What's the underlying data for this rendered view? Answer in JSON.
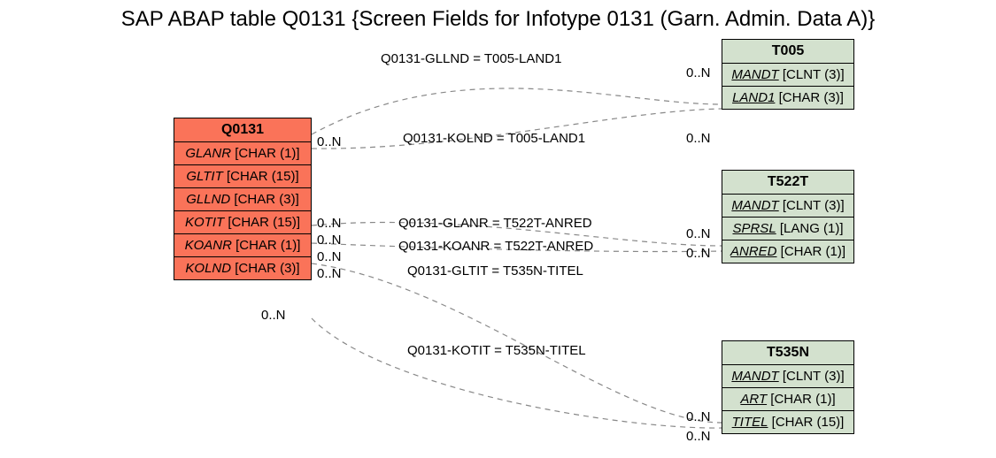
{
  "title": "SAP ABAP table Q0131 {Screen Fields for Infotype 0131 (Garn. Admin. Data A)}",
  "entities": {
    "q0131": {
      "name": "Q0131",
      "fields": [
        {
          "name": "GLANR",
          "type": "[CHAR (1)]",
          "ul": false
        },
        {
          "name": "GLTIT",
          "type": "[CHAR (15)]",
          "ul": false
        },
        {
          "name": "GLLND",
          "type": "[CHAR (3)]",
          "ul": false
        },
        {
          "name": "KOTIT",
          "type": "[CHAR (15)]",
          "ul": false
        },
        {
          "name": "KOANR",
          "type": "[CHAR (1)]",
          "ul": false
        },
        {
          "name": "KOLND",
          "type": "[CHAR (3)]",
          "ul": false
        }
      ]
    },
    "t005": {
      "name": "T005",
      "fields": [
        {
          "name": "MANDT",
          "type": "[CLNT (3)]",
          "ul": true
        },
        {
          "name": "LAND1",
          "type": "[CHAR (3)]",
          "ul": true
        }
      ]
    },
    "t522t": {
      "name": "T522T",
      "fields": [
        {
          "name": "MANDT",
          "type": "[CLNT (3)]",
          "ul": true
        },
        {
          "name": "SPRSL",
          "type": "[LANG (1)]",
          "ul": true
        },
        {
          "name": "ANRED",
          "type": "[CHAR (1)]",
          "ul": true
        }
      ]
    },
    "t535n": {
      "name": "T535N",
      "fields": [
        {
          "name": "MANDT",
          "type": "[CLNT (3)]",
          "ul": true
        },
        {
          "name": "ART",
          "type": "[CHAR (1)]",
          "ul": true
        },
        {
          "name": "TITEL",
          "type": "[CHAR (15)]",
          "ul": true
        }
      ]
    }
  },
  "relations": [
    {
      "text": "Q0131-GLLND = T005-LAND1"
    },
    {
      "text": "Q0131-KOLND = T005-LAND1"
    },
    {
      "text": "Q0131-GLANR = T522T-ANRED"
    },
    {
      "text": "Q0131-KOANR = T522T-ANRED"
    },
    {
      "text": "Q0131-GLTIT = T535N-TITEL"
    },
    {
      "text": "Q0131-KOTIT = T535N-TITEL"
    }
  ],
  "card": {
    "zeroN": "0..N"
  }
}
